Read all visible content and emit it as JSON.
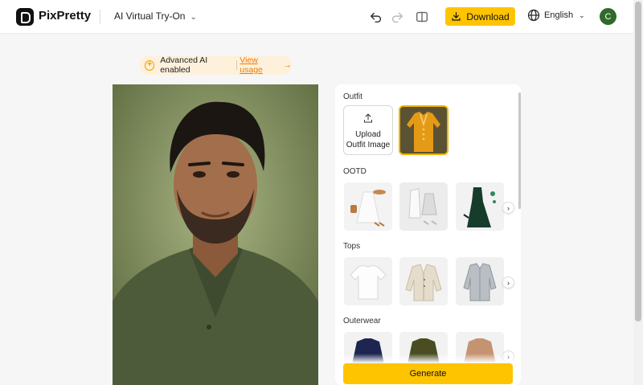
{
  "app": {
    "brand": "PixPretty",
    "tool_name": "AI Virtual Try-On"
  },
  "header": {
    "download_label": "Download",
    "language": "English",
    "avatar_initial": "C",
    "icons": [
      "undo-icon",
      "redo-icon",
      "compare-icon",
      "download-icon",
      "globe-icon"
    ]
  },
  "banner": {
    "status": "Advanced AI enabled",
    "link": "View usage",
    "arrow": "→"
  },
  "panel": {
    "outfit": {
      "title": "Outfit",
      "upload_line1": "Upload",
      "upload_line2": "Outfit Image"
    },
    "ootd": {
      "title": "OOTD",
      "items": [
        "white-dress-look",
        "white-coat-look",
        "green-gown-look"
      ]
    },
    "tops": {
      "title": "Tops",
      "items": [
        "white-tshirt",
        "cream-cardigan",
        "grey-shirt"
      ]
    },
    "outerwear": {
      "title": "Outerwear",
      "items": [
        "navy-jacket",
        "olive-jacket",
        "tan-blazer"
      ]
    },
    "generate_label": "Generate"
  },
  "colors": {
    "accent": "#ffc400",
    "link": "#ef7b00",
    "avatar": "#2f6a2a"
  }
}
